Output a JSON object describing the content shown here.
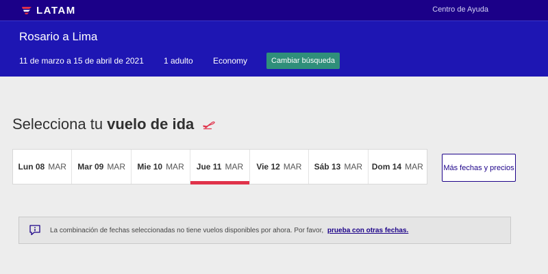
{
  "brand": {
    "name": "LATAM",
    "primary": "#1b0088",
    "accent": "#e0324a",
    "success": "#2f8f7a"
  },
  "topbar": {
    "help_label": "Centro de Ayuda"
  },
  "search": {
    "route": "Rosario a Lima",
    "dates": "11 de marzo a 15 de abril de 2021",
    "passengers": "1 adulto",
    "cabin": "Economy",
    "change_label": "Cambiar búsqueda"
  },
  "section": {
    "title_prefix": "Selecciona tu",
    "title_bold": "vuelo de ida",
    "icon": "plane-takeoff-icon"
  },
  "dates": [
    {
      "day": "Lun 08",
      "month": "MAR",
      "selected": false
    },
    {
      "day": "Mar 09",
      "month": "MAR",
      "selected": false
    },
    {
      "day": "Mie 10",
      "month": "MAR",
      "selected": false
    },
    {
      "day": "Jue 11",
      "month": "MAR",
      "selected": true
    },
    {
      "day": "Vie 12",
      "month": "MAR",
      "selected": false
    },
    {
      "day": "Sáb 13",
      "month": "MAR",
      "selected": false
    },
    {
      "day": "Dom 14",
      "month": "MAR",
      "selected": false
    }
  ],
  "more_dates_label": "Más fechas y precios",
  "notice": {
    "icon": "info-chat-icon",
    "text": "La combinación de fechas seleccionadas no tiene vuelos disponibles por ahora. Por favor,",
    "link_label": "prueba con otras fechas."
  }
}
